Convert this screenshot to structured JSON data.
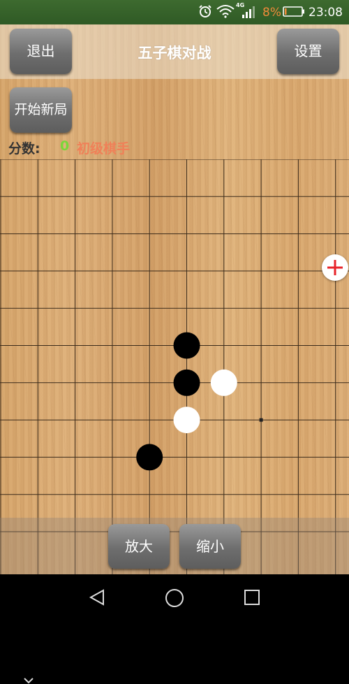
{
  "status_bar": {
    "network_type": "4G",
    "battery_percent": "8%",
    "time": "23:08",
    "colors": {
      "battery_text": "#f08a3a"
    }
  },
  "header": {
    "exit_label": "退出",
    "title": "五子棋对战",
    "settings_label": "设置"
  },
  "controls": {
    "new_game_label": "开始新局"
  },
  "score": {
    "label": "分数:",
    "value": "0",
    "rank": "初级棋手",
    "colors": {
      "value": "#7bd63a",
      "rank": "#f08058"
    }
  },
  "board": {
    "grid_columns": 10,
    "grid_rows": 11,
    "stones": [
      {
        "color": "black",
        "col": 5,
        "row": 5
      },
      {
        "color": "black",
        "col": 5,
        "row": 6
      },
      {
        "color": "white",
        "col": 6,
        "row": 6
      },
      {
        "color": "white",
        "col": 5,
        "row": 7
      },
      {
        "color": "black",
        "col": 4,
        "row": 8
      }
    ],
    "marker": {
      "col": 7,
      "row": 7
    },
    "zoom_fab_icon": "plus-icon"
  },
  "bottom": {
    "zoom_in_label": "放大",
    "zoom_out_label": "缩小"
  },
  "nav": {
    "icons": [
      "chevron-down-icon",
      "back-icon",
      "home-icon",
      "recents-icon"
    ]
  }
}
